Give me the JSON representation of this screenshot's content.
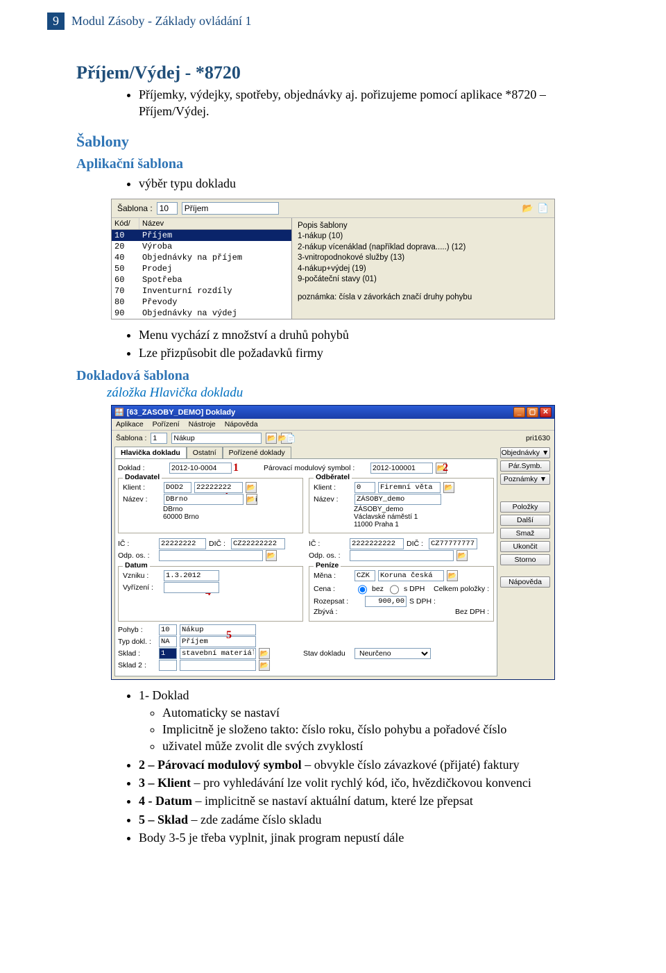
{
  "page_number": "9",
  "header_title": "Modul Zásoby - Základy ovládání 1",
  "h_prijem": "Příjem/Výdej - *8720",
  "bullet_intro": "Příjemky, výdejky, spotřeby, objednávky aj. pořizujeme pomocí aplikace *8720 – Příjem/Výdej.",
  "h_sablony": "Šablony",
  "h_aplsab": "Aplikační šablona",
  "bullet_vyber": "výběr typu dokladu",
  "shot1": {
    "sablona_label": "Šablona :",
    "sablona_code": "10",
    "sablona_name": "Příjem",
    "list_header_kod": "Kód/",
    "list_header_nazev": "Název",
    "rows": [
      {
        "kod": "10",
        "nazev": "Příjem"
      },
      {
        "kod": "20",
        "nazev": "Výroba"
      },
      {
        "kod": "40",
        "nazev": "Objednávky na příjem"
      },
      {
        "kod": "50",
        "nazev": "Prodej"
      },
      {
        "kod": "60",
        "nazev": "Spotřeba"
      },
      {
        "kod": "70",
        "nazev": "Inventurní rozdíly"
      },
      {
        "kod": "80",
        "nazev": "Převody"
      },
      {
        "kod": "90",
        "nazev": "Objednávky na výdej"
      }
    ],
    "desc_title": "Popis šablony",
    "desc_lines": [
      "1-nákup (10)",
      "2-nákup vícenáklad (například doprava.....) (12)",
      "3-vnitropodnokové služby (13)",
      "4-nákup+výdej (19)",
      "9-počáteční stavy (01)",
      "",
      "poznámka: čísla v závorkách značí druhy pohybu"
    ]
  },
  "bullet_menu": "Menu vychází z množství a druhů pohybů",
  "bullet_prizp": "Lze přizpůsobit dle požadavků firmy",
  "h_doksab": "Dokladová šablona",
  "h_zalozka": "záložka Hlavička dokladu",
  "shot2": {
    "title": "[63_ZASOBY_DEMO] Doklady",
    "menu": [
      "Aplikace",
      "Pořízení",
      "Nástroje",
      "Nápověda"
    ],
    "sablona_label": "Šablona :",
    "sablona_code": "1",
    "sablona_name": "Nákup",
    "user": "pri1630",
    "tabs": [
      "Hlavička dokladu",
      "Ostatní",
      "Pořízené doklady"
    ],
    "doklad_label": "Doklad :",
    "doklad_val": "2012-10-0004",
    "pms_label": "Párovací modulový symbol :",
    "pms_val": "2012-100001",
    "dodavatel_legend": "Dodavatel",
    "odberatel_legend": "Odběratel",
    "klient_label": "Klient :",
    "nazev_label": "Název :",
    "klient_dod_kod": "DOD2",
    "klient_dod_ic": "22222222",
    "nazev_dod": "DBrno",
    "adresa_dod1": "DBrno",
    "adresa_dod2": "60000  Brno",
    "klient_odb_kod": "0",
    "klient_odb_text": "Firemní věta",
    "nazev_odb": "ZÁSOBY_demo",
    "adresa_odb1": "ZÁSOBY_demo",
    "adresa_odb2": "Václavské náměstí 1",
    "adresa_odb3": "11000  Praha 1",
    "ic_label": "IČ :",
    "dic_label": "DIČ :",
    "ic_dod": "22222222",
    "dic_dod": "CZ22222222",
    "ic_odb": "2222222222",
    "dic_odb": "CZ77777777",
    "odpos_label": "Odp. os. :",
    "datum_legend": "Datum",
    "penize_legend": "Peníze",
    "vzniku_label": "Vzniku :",
    "vzniku_val": "1.3.2012",
    "vyrizeni_label": "Vyřízení :",
    "pohyb_label": "Pohyb :",
    "pohyb_kod": "10",
    "pohyb_nazev": "Nákup",
    "typdokl_label": "Typ dokl. :",
    "typdokl_kod": "NA",
    "typdokl_nazev": "Příjem",
    "sklad_label": "Sklad :",
    "sklad_val": "1",
    "sklad_nazev": "stavební materiál",
    "sklad2_label": "Sklad 2 :",
    "mena_label": "Měna :",
    "mena_kod": "CZK",
    "mena_nazev": "Koruna česká",
    "cena_label": "Cena :",
    "cena_bez": "bez",
    "cena_s": "s DPH",
    "celkem_label": "Celkem položky :",
    "rozepsat_label": "Rozepsat :",
    "rozepsat_val": "900,00",
    "rozepsat_suffix": "S DPH :",
    "zbyva_label": "Zbývá :",
    "bezdph_label": "Bez DPH :",
    "stavdokl_label": "Stav dokladu",
    "stavdokl_val": "Neurčeno",
    "buttons": [
      "Objednávky ▼",
      "Pár.Symb.",
      "Poznámky ▼",
      "Položky",
      "Další",
      "Smaž",
      "Ukončit",
      "Storno",
      "Nápověda"
    ]
  },
  "legend": {
    "l1_title": "1- Doklad",
    "l1a": "Automaticky se nastaví",
    "l1b": "Implicitně je složeno takto: číslo roku, číslo pohybu a pořadové číslo",
    "l1c": "uživatel může zvolit dle svých zvyklostí",
    "l2": "2 – Párovací modulový symbol – obvykle číslo závazkové (přijaté) faktury",
    "l3": "3 – Klient – pro vyhledávání lze volit rychlý kód, ičo, hvězdičkovou konvenci",
    "l4": "4 - Datum – implicitně se nastaví aktuální datum, které lze přepsat",
    "l5": "5 – Sklad – zde zadáme číslo skladu",
    "l6": "Body 3-5 je třeba vyplnit, jinak program nepustí dále",
    "l2b": "2 – Párovací modulový symbol",
    "l3b": "3 – Klient",
    "l4b": "4 - Datum",
    "l5b": "5 – Sklad"
  }
}
